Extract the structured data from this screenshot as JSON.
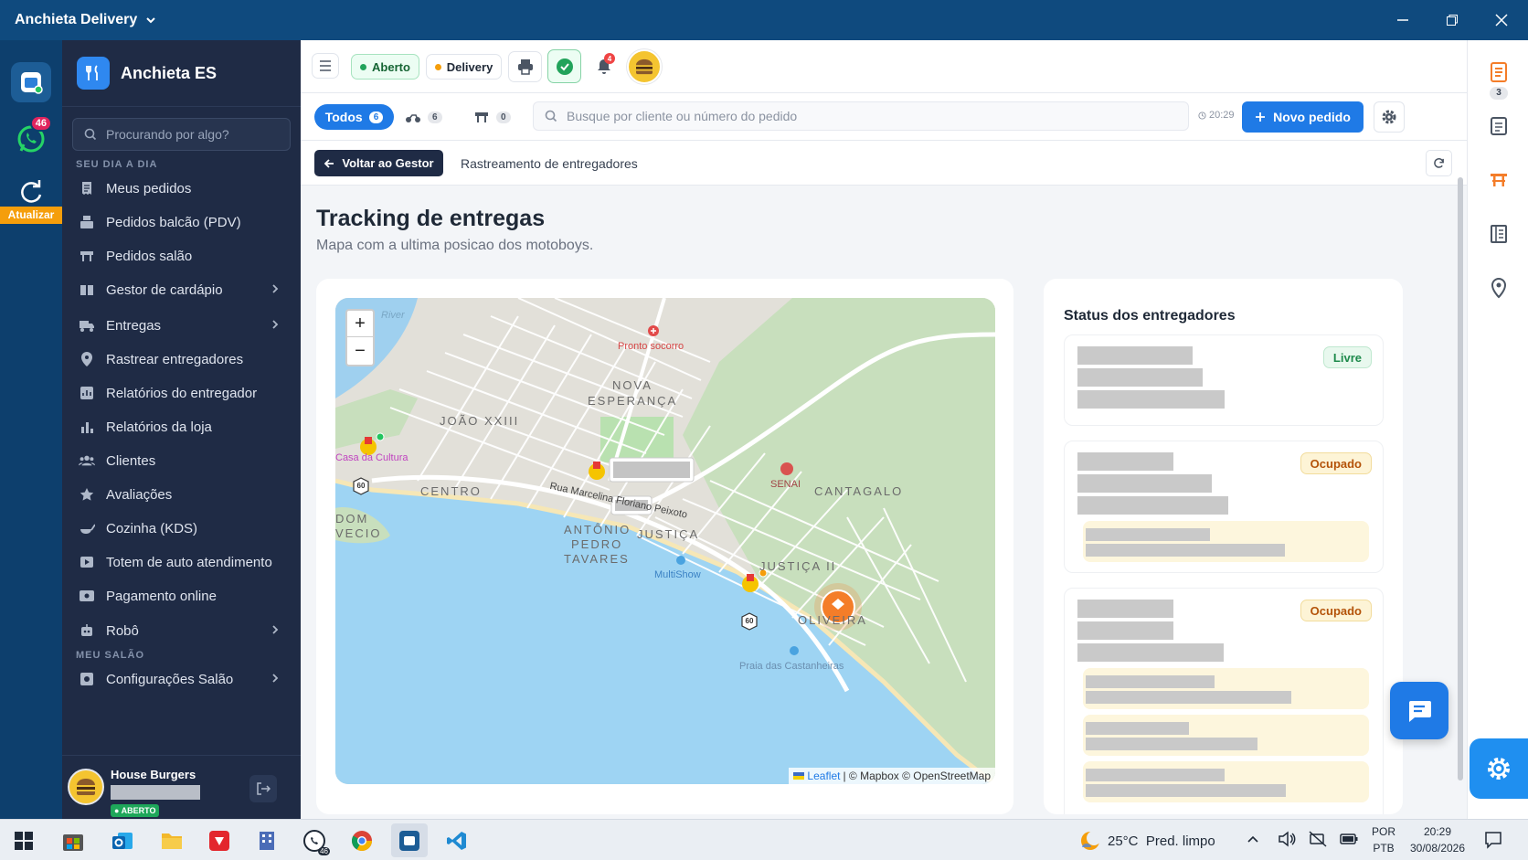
{
  "window": {
    "title": "Anchieta Delivery",
    "minimize_icon": "minimize-icon",
    "restore_icon": "restore-icon",
    "close_icon": "close-icon"
  },
  "rail": {
    "whatsapp_badge": "46",
    "refresh_label": "Atualizar"
  },
  "sidebar": {
    "brand": "Anchieta ES",
    "search_placeholder": "Procurando por algo?",
    "section1": "SEU DIA A DIA",
    "items": [
      {
        "label": "Meus pedidos",
        "icon": "receipt-icon"
      },
      {
        "label": "Pedidos balcão (PDV)",
        "icon": "cash-register-icon"
      },
      {
        "label": "Pedidos salão",
        "icon": "table-icon"
      },
      {
        "label": "Gestor de cardápio",
        "icon": "menu-book-icon"
      },
      {
        "label": "Entregas",
        "icon": "truck-icon"
      },
      {
        "label": "Rastrear entregadores",
        "icon": "map-pin-icon"
      },
      {
        "label": "Relatórios do entregador",
        "icon": "report-icon"
      },
      {
        "label": "Relatórios da loja",
        "icon": "bar-chart-icon"
      },
      {
        "label": "Clientes",
        "icon": "users-icon"
      },
      {
        "label": "Avaliações",
        "icon": "star-icon"
      },
      {
        "label": "Cozinha (KDS)",
        "icon": "kitchen-icon"
      },
      {
        "label": "Totem de auto atendimento",
        "icon": "kiosk-icon"
      },
      {
        "label": "Pagamento online",
        "icon": "payment-icon"
      },
      {
        "label": "Robô",
        "icon": "robot-icon"
      }
    ],
    "section2": "MEU SALÃO",
    "salon_item": {
      "label": "Configurações Salão",
      "icon": "settings-box-icon"
    },
    "footer": {
      "name": "House Burgers",
      "status": "● ABERTO"
    }
  },
  "topbar": {
    "status_open": "Aberto",
    "status_delivery": "Delivery",
    "bell_badge": "4"
  },
  "filters": {
    "all_label": "Todos",
    "all_count": "6",
    "delivery_count": "6",
    "table_count": "0",
    "search_placeholder": "Busque por cliente ou número do pedido",
    "time": "20:29",
    "new_order": "Novo pedido"
  },
  "breadcrumb": {
    "back_label": "Voltar ao Gestor",
    "current": "Rastreamento de entregadores"
  },
  "page": {
    "title": "Tracking de entregas",
    "subtitle": "Mapa com a ultima posicao dos motoboys."
  },
  "map": {
    "zoom_in": "+",
    "zoom_out": "−",
    "labels": {
      "river": "River",
      "hospital": "Pronto socorro",
      "nova": "NOVA",
      "esperanca": "ESPERANÇA",
      "joao": "JOÃO XXIII",
      "casa": "Casa da Cultura",
      "centro": "CENTRO",
      "rua": "Rua Marcelina Floriano Peixoto",
      "senai": "SENAI",
      "cantagalo": "CANTAGALO",
      "antonio": "ANTÔNIO",
      "pedro": "PEDRO",
      "tavares": "TAVARES",
      "justica": "JUSTIÇA",
      "multishow": "MultiShow",
      "justica2": "JUSTIÇA II",
      "oliveira": "OLIVEIRA",
      "praia": "Praia das Castanheiras",
      "dom": "DOM",
      "vecio": "VECIO",
      "route": "60"
    },
    "attribution_leaflet": "Leaflet",
    "attribution_rest": " | © Mapbox © OpenStreetMap"
  },
  "status_panel": {
    "title": "Status dos entregadores",
    "badges": [
      "Livre",
      "Ocupado",
      "Ocupado"
    ]
  },
  "right_panel": {
    "orders_badge": "3"
  },
  "taskbar": {
    "weather": "25°C  Pred. limpo",
    "lang1": "POR",
    "lang2": "PTB",
    "time": "20:29",
    "date": "30/08/2026",
    "chrome_badge": "46"
  },
  "colors": {
    "primary": "#1f7ae6",
    "sidebar_bg": "#1f2b45",
    "titlebar": "#0f4a7e",
    "accent_orange": "#f47d29",
    "green": "#22a35b"
  }
}
